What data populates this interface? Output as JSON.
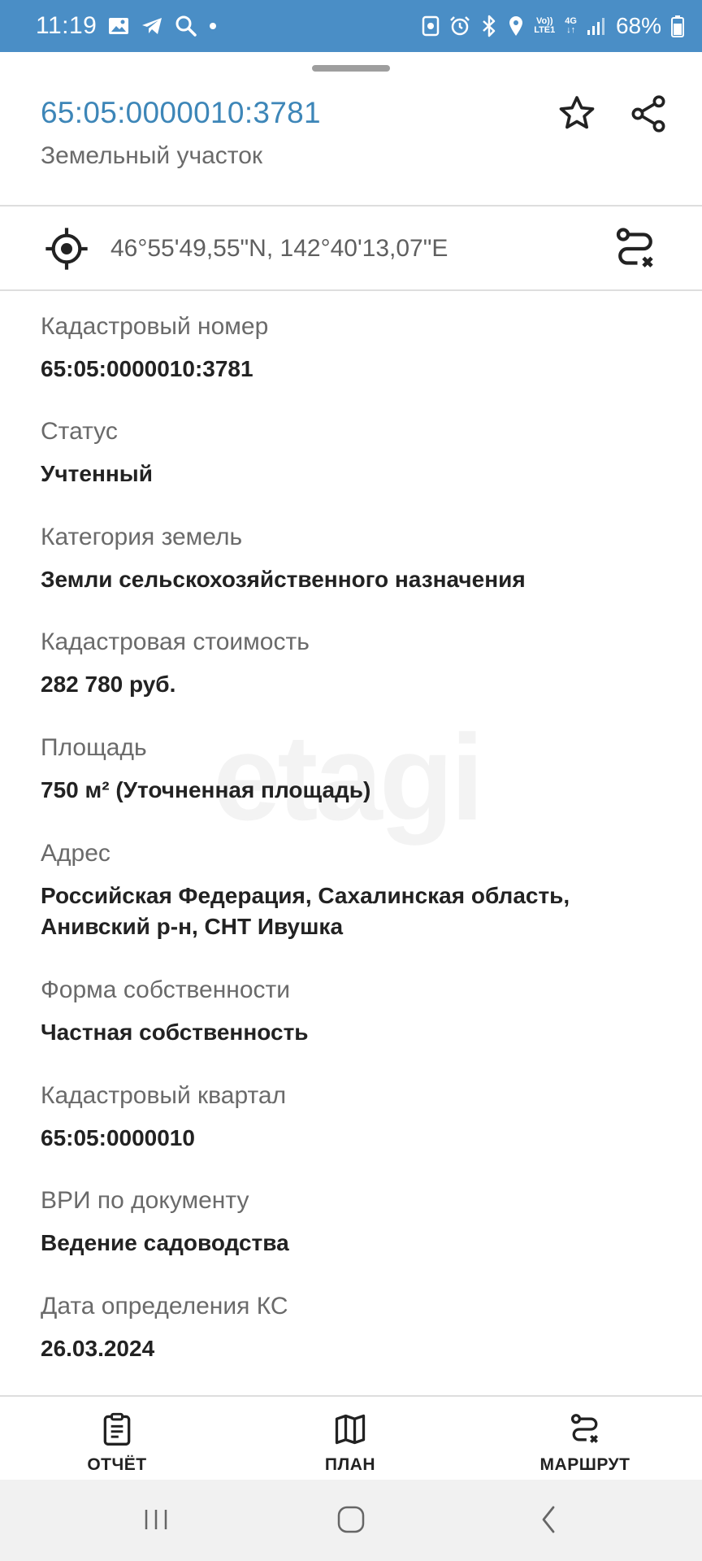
{
  "status_bar": {
    "time": "11:19",
    "net_top": "Vo))",
    "net_bottom": "LTE1",
    "net_gen": "4G",
    "battery": "68%"
  },
  "header": {
    "title": "65:05:0000010:3781",
    "subtitle": "Земельный участок"
  },
  "coordinates": "46°55'49,55\"N, 142°40'13,07\"E",
  "watermark": "etagi",
  "fields": [
    {
      "label": "Кадастровый номер",
      "value": "65:05:0000010:3781"
    },
    {
      "label": "Статус",
      "value": "Учтенный"
    },
    {
      "label": "Категория земель",
      "value": "Земли сельскохозяйственного назначения"
    },
    {
      "label": "Кадастровая стоимость",
      "value": "282 780 руб."
    },
    {
      "label": "Площадь",
      "value": "750 м² (Уточненная площадь)"
    },
    {
      "label": "Адрес",
      "value_line1": "Российская Федерация, Сахалинская область,",
      "value_line2": "Анивский р-н, СНТ Ивушка"
    },
    {
      "label": "Форма собственности",
      "value": "Частная собственность"
    },
    {
      "label": "Кадастровый квартал",
      "value": "65:05:0000010"
    },
    {
      "label": "ВРИ по документу",
      "value": "Ведение садоводства"
    },
    {
      "label": "Дата определения КС",
      "value": "26.03.2024"
    }
  ],
  "actions": [
    {
      "label": "ОТЧЁТ",
      "icon": "report-icon"
    },
    {
      "label": "ПЛАН",
      "icon": "map-icon"
    },
    {
      "label": "МАРШРУТ",
      "icon": "route-icon"
    }
  ],
  "colors": {
    "status_bar": "#4a8ec6",
    "title": "#3d86b8",
    "label": "#6a6a6a",
    "value": "#222222"
  }
}
